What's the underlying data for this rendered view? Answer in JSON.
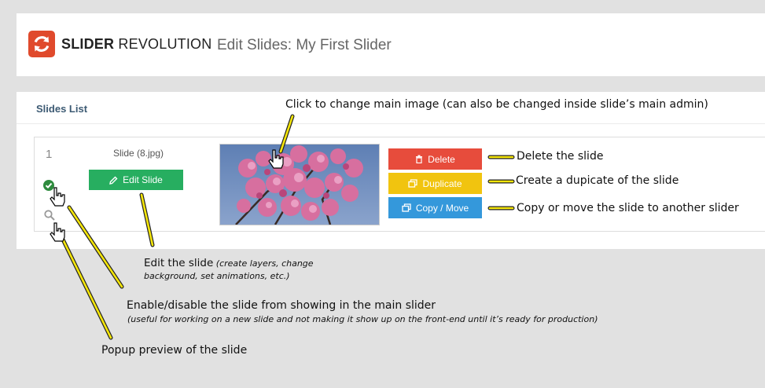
{
  "header": {
    "brand_bold": "SLIDER",
    "brand_rest": " REVOLUTION",
    "page_title": "Edit Slides: My First Slider"
  },
  "panel": {
    "title": "Slides List",
    "slide": {
      "number": "1",
      "name": "Slide (8.jpg)",
      "edit_label": "Edit Slide",
      "delete_label": "Delete",
      "duplicate_label": "Duplicate",
      "copy_move_label": "Copy / Move"
    }
  },
  "annotations": {
    "image": "Click to change main image (can also be changed inside slide’s main admin)",
    "delete": "Delete the slide",
    "duplicate": "Create a dupicate of the slide",
    "copy_move": "Copy or move the slide to another slider",
    "edit_main": "Edit the slide",
    "edit_sub": "(create layers, change background, set animations, etc.)",
    "enable_main": "Enable/disable the slide from showing in the main slider",
    "enable_sub": "(useful for working on a new slide and not making it show up on the front-end until it’s ready for production)",
    "preview": "Popup preview of the slide"
  },
  "colors": {
    "brand": "#e04a2c",
    "edit": "#27ae60",
    "delete": "#e74c3c",
    "duplicate": "#f1c40f",
    "copy_move": "#3498db",
    "callout_line": "#f5e60a"
  },
  "icons": [
    "refresh-logo-icon",
    "pencil-icon",
    "trash-icon",
    "duplicate-icon",
    "copy-move-icon",
    "check-circle-icon",
    "magnifier-icon",
    "pointer-hand-icon"
  ]
}
